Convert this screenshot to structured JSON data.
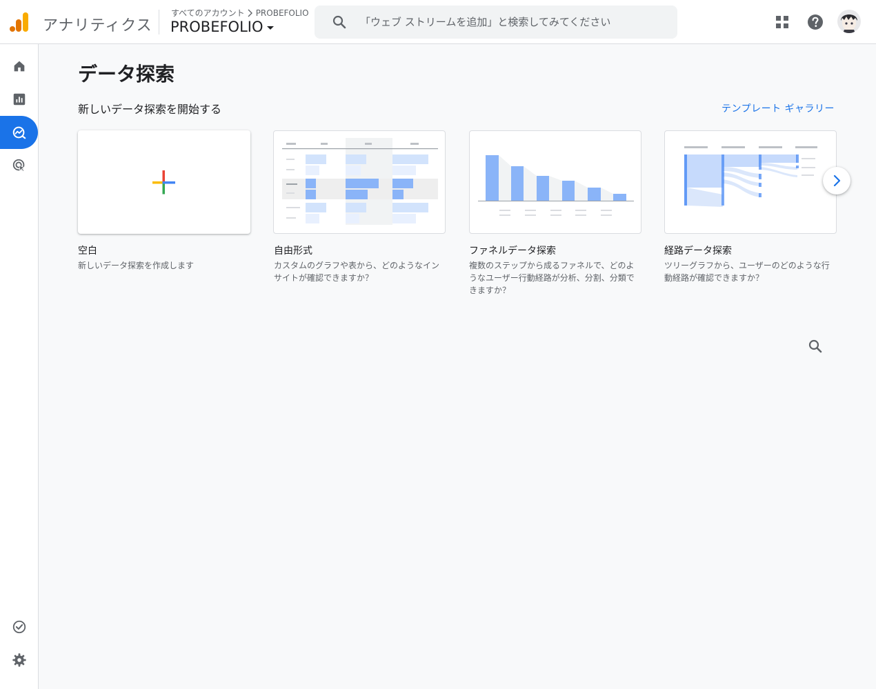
{
  "header": {
    "app_name": "アナリティクス",
    "breadcrumb": [
      "すべてのアカウント",
      "PROBEFOLIO"
    ],
    "property_name": "PROBEFOLIO",
    "search_placeholder": "「ウェブ ストリームを追加」と検索してみてください",
    "icons": [
      "apps-grid-icon",
      "help-icon"
    ]
  },
  "sidebar": {
    "items": [
      {
        "name": "home",
        "icon": "home-icon"
      },
      {
        "name": "reports",
        "icon": "bar-chart-icon"
      },
      {
        "name": "explore",
        "icon": "explore-icon",
        "active": true
      },
      {
        "name": "advertising",
        "icon": "advertising-icon"
      }
    ],
    "bottom_items": [
      {
        "name": "configure",
        "icon": "check-circle-icon"
      },
      {
        "name": "admin",
        "icon": "gear-icon"
      }
    ]
  },
  "main": {
    "page_title": "データ探索",
    "section_title": "新しいデータ探索を開始する",
    "template_gallery_label": "テンプレート ギャラリー",
    "cards": [
      {
        "title": "空白",
        "description": "新しいデータ探索を作成します"
      },
      {
        "title": "自由形式",
        "description": "カスタムのグラフや表から、どのようなインサイトが確認できますか？"
      },
      {
        "title": "ファネルデータ探索",
        "description": "複数のステップから成るファネルで、どのようなユーザー行動経路が分析、分割、分類できますか？"
      },
      {
        "title": "経路データ探索",
        "description": "ツリーグラフから、ユーザーのどのような行動経路が確認できますか？"
      }
    ]
  },
  "colors": {
    "accent": "#1a73e8",
    "chart_blue": "#8ab4f8",
    "chart_light_blue": "#d2e3fc"
  }
}
